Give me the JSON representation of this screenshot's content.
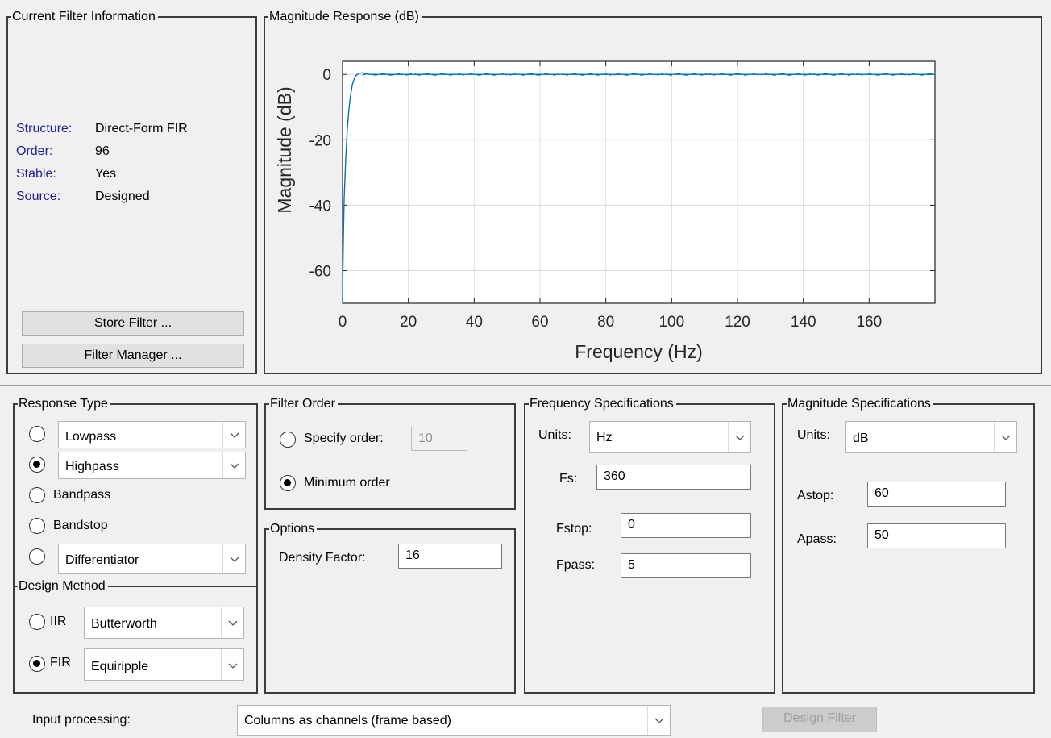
{
  "filter_info": {
    "title": "Current Filter Information",
    "rows": [
      {
        "key": "Structure:",
        "value": "Direct-Form FIR"
      },
      {
        "key": "Order:",
        "value": "96"
      },
      {
        "key": "Stable:",
        "value": "Yes"
      },
      {
        "key": "Source:",
        "value": "Designed"
      }
    ],
    "store_label": "Store Filter ...",
    "manager_label": "Filter Manager ...",
    "key_color": "#1f1f9e"
  },
  "magnitude_panel": {
    "title": "Magnitude Response (dB)"
  },
  "chart_data": {
    "type": "line",
    "xlabel": "Frequency (Hz)",
    "ylabel": "Magnitude (dB)",
    "xlim": [
      0,
      180
    ],
    "ylim": [
      -70,
      4
    ],
    "xticks": [
      "0",
      "20",
      "40",
      "60",
      "80",
      "100",
      "120",
      "140",
      "160"
    ],
    "yticks": [
      "0",
      "-20",
      "-40",
      "-60"
    ],
    "grid": true,
    "line_color": "#0072bd",
    "series": [
      {
        "x": [
          0,
          0.1,
          0.3,
          0.5,
          1,
          1.5,
          2,
          2.5,
          3,
          3.5,
          4,
          4.5,
          5,
          6,
          8,
          10,
          20,
          40,
          60,
          80,
          100,
          120,
          140,
          160,
          180
        ],
        "values": [
          -70,
          -60,
          -48,
          -38,
          -25,
          -16,
          -10,
          -6,
          -3,
          -1.5,
          -0.5,
          0,
          0.3,
          0.5,
          0,
          0,
          0,
          0,
          0,
          0,
          0,
          0,
          0,
          0,
          0
        ]
      }
    ]
  },
  "response_type": {
    "title": "Response Type",
    "options": [
      {
        "label": "Lowpass",
        "checked": false
      },
      {
        "label": "Highpass",
        "checked": true
      },
      {
        "label": "Bandpass",
        "checked": false
      },
      {
        "label": "Bandstop",
        "checked": false
      },
      {
        "label": "Differentiator",
        "checked": false
      }
    ]
  },
  "design_method": {
    "title": "Design Method",
    "iir": {
      "label": "IIR",
      "value": "Butterworth",
      "checked": false
    },
    "fir": {
      "label": "FIR",
      "value": "Equiripple",
      "checked": true
    }
  },
  "filter_order": {
    "title": "Filter Order",
    "specify_label": "Specify order:",
    "specify_value": "10",
    "minimum_label": "Minimum order",
    "selected": "minimum"
  },
  "options": {
    "title": "Options",
    "density_label": "Density Factor:",
    "density_value": "16"
  },
  "freq_specs": {
    "title": "Frequency Specifications",
    "units_label": "Units:",
    "units_value": "Hz",
    "fs_label": "Fs:",
    "fs_value": "360",
    "fstop_label": "Fstop:",
    "fstop_value": "0",
    "fpass_label": "Fpass:",
    "fpass_value": "5"
  },
  "mag_specs": {
    "title": "Magnitude Specifications",
    "units_label": "Units:",
    "units_value": "dB",
    "astop_label": "Astop:",
    "astop_value": "60",
    "apass_label": "Apass:",
    "apass_value": "50"
  },
  "footer": {
    "input_label": "Input processing:",
    "input_value": "Columns as channels (frame based)",
    "design_label": "Design Filter"
  }
}
